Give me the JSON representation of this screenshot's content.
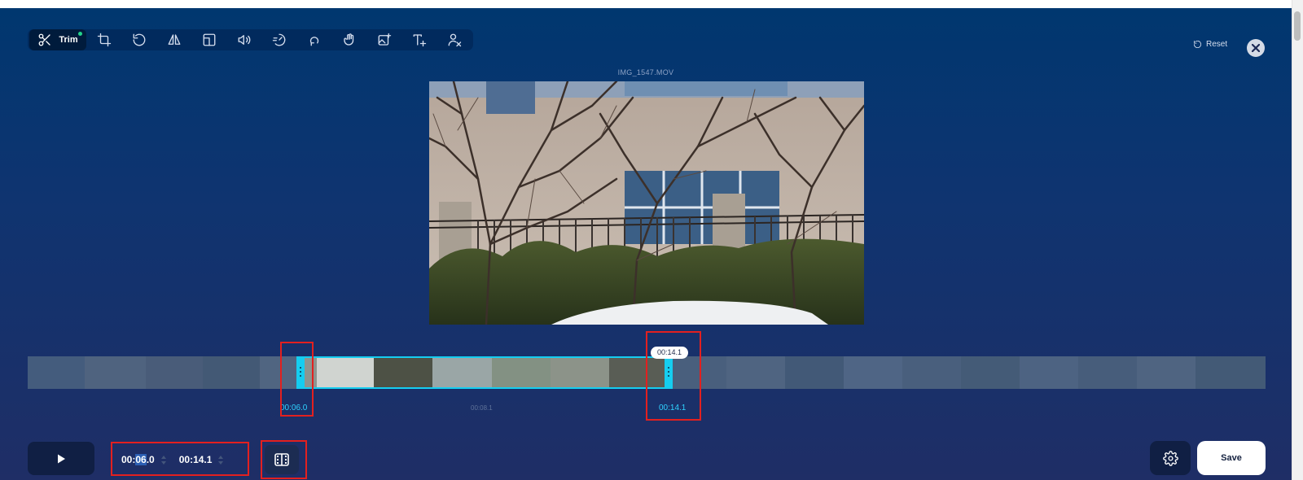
{
  "toolbar": {
    "active_tool": {
      "label": "Trim",
      "icon": "scissors-icon"
    },
    "tools": [
      {
        "name": "crop-tool-button",
        "icon": "crop-icon"
      },
      {
        "name": "rotate-tool-button",
        "icon": "rotate-icon"
      },
      {
        "name": "flip-tool-button",
        "icon": "flip-icon"
      },
      {
        "name": "resize-tool-button",
        "icon": "resize-icon"
      },
      {
        "name": "volume-tool-button",
        "icon": "speaker-icon"
      },
      {
        "name": "speed-tool-button",
        "icon": "speed-icon"
      },
      {
        "name": "loop-tool-button",
        "icon": "loop-icon"
      },
      {
        "name": "stabilize-tool-button",
        "icon": "stabilize-icon"
      },
      {
        "name": "add-image-tool-button",
        "icon": "add-image-icon"
      },
      {
        "name": "add-text-tool-button",
        "icon": "add-text-icon"
      },
      {
        "name": "remove-watermark-tool-button",
        "icon": "remove-person-icon"
      }
    ],
    "reset_label": "Reset"
  },
  "video": {
    "file_name": "IMG_1547.MOV"
  },
  "timeline": {
    "start_label": "00:06.0",
    "mid_label": "00:08.1",
    "end_label": "00:14.1",
    "bubble_label": "00:14.1",
    "selection_start_fraction": 0.217,
    "selection_end_fraction": 0.521
  },
  "controls": {
    "start_time": {
      "prefix": "00:",
      "highlight": "06",
      "suffix": ".0"
    },
    "end_time": "00:14.1",
    "save_label": "Save"
  },
  "colors": {
    "accent": "#15cdf0",
    "highlight_box": "#e3201f",
    "active_dot": "#22d28a"
  }
}
